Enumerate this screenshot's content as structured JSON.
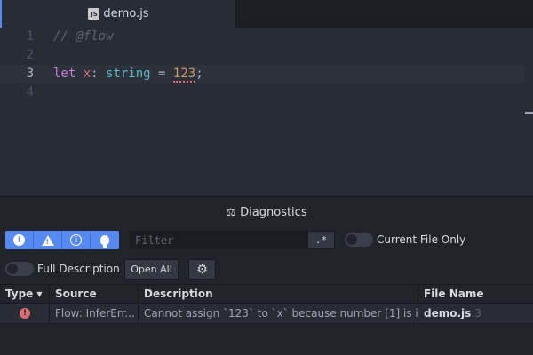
{
  "tab": {
    "icon": "js-file-icon",
    "icon_text": "JS",
    "title": "demo.js"
  },
  "editor": {
    "lines": [
      {
        "number": "1",
        "comment": "// @flow"
      },
      {
        "number": "2"
      },
      {
        "number": "3",
        "keyword": "let",
        "space1": " ",
        "var": "x",
        "colon": ": ",
        "type": "string",
        "eq": " = ",
        "num": "123",
        "semi": ";"
      },
      {
        "number": "4"
      }
    ]
  },
  "diagnostics": {
    "title": "Diagnostics",
    "title_icon": "scale-icon",
    "filter_buttons": [
      {
        "icon": "error-icon",
        "glyph": "!"
      },
      {
        "icon": "warning-icon",
        "glyph": "!"
      },
      {
        "icon": "info-icon",
        "glyph": "i"
      },
      {
        "icon": "hint-icon"
      }
    ],
    "filter_placeholder": "Filter",
    "regex_label": ".*",
    "current_file_label": "Current File Only",
    "full_description_label": "Full Description",
    "open_all_label": "Open All",
    "settings_icon": "gear-icon",
    "settings_glyph": "⚙",
    "columns": {
      "type": "Type",
      "source": "Source",
      "description": "Description",
      "file": "File Name"
    },
    "rows": [
      {
        "type_glyph": "!",
        "source": "Flow: InferErr...",
        "description": "Cannot assign `123` to `x` because number [1] is i...",
        "file_name": "demo.js",
        "file_line": ":3"
      }
    ]
  },
  "colors": {
    "accent": "#568af2",
    "error": "#e06c75",
    "background": "#282c34"
  }
}
